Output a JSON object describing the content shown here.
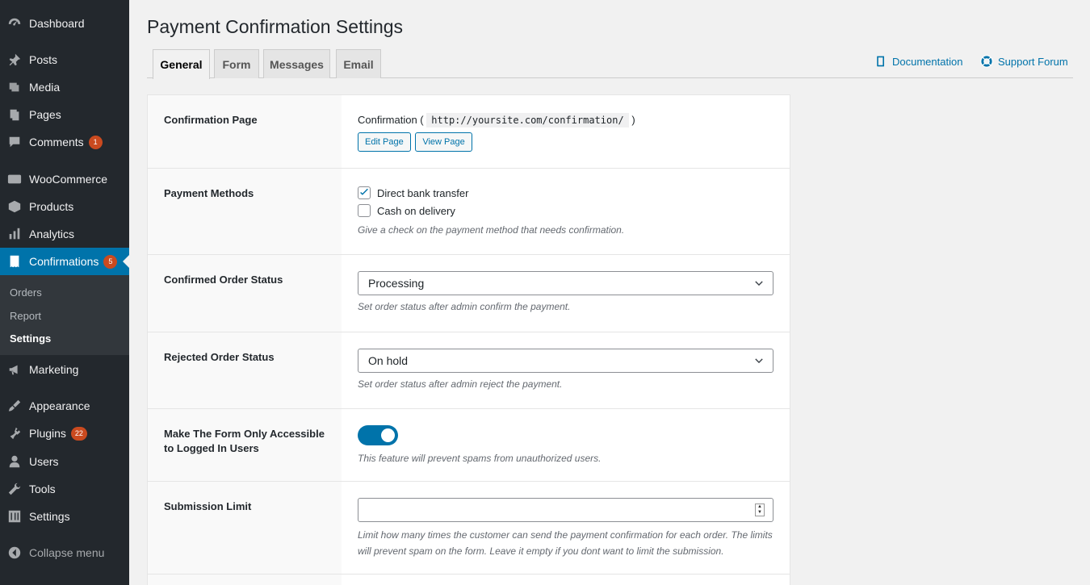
{
  "sidebar": {
    "items": [
      {
        "label": "Dashboard",
        "icon": "dashboard-icon"
      },
      {
        "label": "Posts",
        "icon": "pin-icon"
      },
      {
        "label": "Media",
        "icon": "media-icon"
      },
      {
        "label": "Pages",
        "icon": "pages-icon"
      },
      {
        "label": "Comments",
        "icon": "comment-icon",
        "badge": "1"
      },
      {
        "label": "WooCommerce",
        "icon": "woo-icon"
      },
      {
        "label": "Products",
        "icon": "box-icon"
      },
      {
        "label": "Analytics",
        "icon": "bar-chart-icon"
      },
      {
        "label": "Confirmations",
        "icon": "receipt-icon",
        "badge": "5"
      },
      {
        "label": "Marketing",
        "icon": "megaphone-icon"
      },
      {
        "label": "Appearance",
        "icon": "paint-icon"
      },
      {
        "label": "Plugins",
        "icon": "plug-icon",
        "badge": "22"
      },
      {
        "label": "Users",
        "icon": "user-icon"
      },
      {
        "label": "Tools",
        "icon": "wrench-icon"
      },
      {
        "label": "Settings",
        "icon": "sliders-icon"
      },
      {
        "label": "Collapse menu",
        "icon": "collapse-icon"
      }
    ],
    "submenu": [
      "Orders",
      "Report",
      "Settings"
    ]
  },
  "page": {
    "title": "Payment Confirmation Settings"
  },
  "tabs": [
    "General",
    "Form",
    "Messages",
    "Email"
  ],
  "links": {
    "documentation": "Documentation",
    "support": "Support Forum"
  },
  "rows": {
    "confirmation_page": {
      "label": "Confirmation Page",
      "page_name": "Confirmation (",
      "url": "http://yoursite.com/confirmation/",
      "close": ")",
      "edit_button": "Edit Page",
      "view_button": "View Page"
    },
    "payment_methods": {
      "label": "Payment Methods",
      "option1": "Direct bank transfer",
      "option2": "Cash on delivery",
      "desc": "Give a check on the payment method that needs confirmation."
    },
    "confirmed_status": {
      "label": "Confirmed Order Status",
      "value": "Processing",
      "desc": "Set order status after admin confirm the payment."
    },
    "rejected_status": {
      "label": "Rejected Order Status",
      "value": "On hold",
      "desc": "Set order status after admin reject the payment."
    },
    "logged_in": {
      "label": "Make The Form Only Accessible to Logged In Users",
      "desc": "This feature will prevent spams from unauthorized users."
    },
    "submission_limit": {
      "label": "Submission Limit",
      "desc": "Limit how many times the customer can send the payment confirmation for each order. The limits will prevent spam on the form. Leave it empty if you dont want to limit the submission."
    }
  }
}
